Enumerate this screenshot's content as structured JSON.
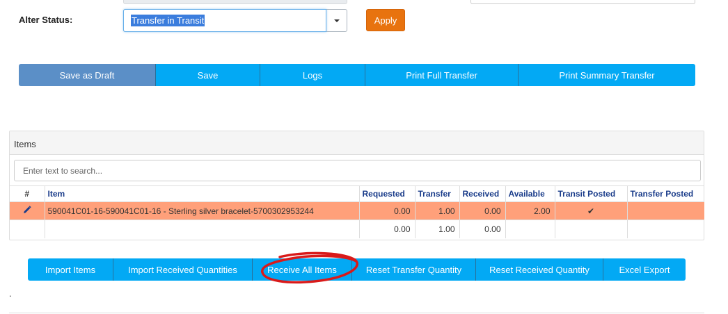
{
  "status": {
    "label": "Alter Status:",
    "selected": "Transfer in Transit",
    "apply_label": "Apply"
  },
  "actions": {
    "save_draft": "Save as Draft",
    "save": "Save",
    "logs": "Logs",
    "print_full": "Print Full Transfer",
    "print_summary": "Print Summary Transfer"
  },
  "items": {
    "title": "Items",
    "search_placeholder": "Enter text to search...",
    "columns": [
      "#",
      "Item",
      "Requested",
      "Transfer",
      "Received",
      "Available",
      "Transit Posted",
      "Transfer Posted"
    ],
    "rows": [
      {
        "item": "590041C01-16-590041C01-16 - Sterling silver bracelet-5700302953244",
        "requested": "0.00",
        "transfer": "1.00",
        "received": "0.00",
        "available": "2.00",
        "transit_posted": "✔",
        "transfer_posted": ""
      }
    ],
    "totals": {
      "requested": "0.00",
      "transfer": "1.00",
      "received": "0.00"
    }
  },
  "bottom_actions": {
    "import_items": "Import Items",
    "import_received": "Import Received Quantities",
    "receive_all": "Receive All Items",
    "reset_transfer": "Reset Transfer Quantity",
    "reset_received": "Reset Received Quantity",
    "excel_export": "Excel Export"
  },
  "colors": {
    "primary_button": "#03a9f4",
    "draft_button": "#5b8fc7",
    "apply_button": "#e8730f",
    "row_highlight": "#ffa07a",
    "annotation": "#d91a1a"
  },
  "footer_mark": "."
}
